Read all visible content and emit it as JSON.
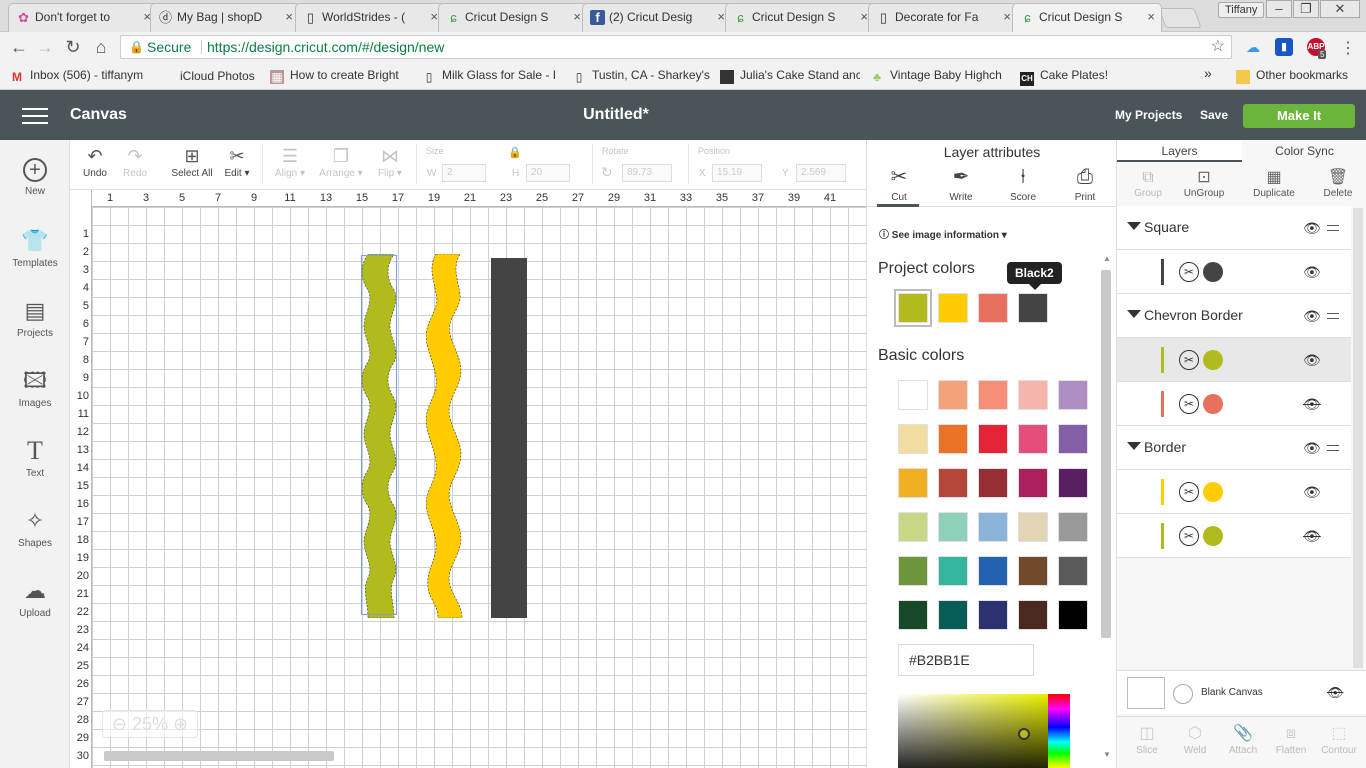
{
  "browser": {
    "tabs": [
      {
        "title": "Don't forget to",
        "icon": "flower-icon"
      },
      {
        "title": "My Bag | shopD",
        "icon": "shop-icon"
      },
      {
        "title": "WorldStrides - (",
        "icon": "page-icon"
      },
      {
        "title": "Cricut Design S",
        "icon": "cricut-icon"
      },
      {
        "title": "(2) Cricut Desig",
        "icon": "facebook-icon"
      },
      {
        "title": "Cricut Design S",
        "icon": "cricut-icon"
      },
      {
        "title": "Decorate for Fa",
        "icon": "page-icon"
      },
      {
        "title": "Cricut Design S",
        "icon": "cricut-icon"
      }
    ],
    "profile_name": "Tiffany",
    "address": {
      "secure_label": "Secure",
      "url": "https://design.cricut.com/#/design/new"
    },
    "ext_abp_count": "5",
    "bookmarks": [
      {
        "label": "Inbox (506) - tiffanym",
        "icon": "gmail-icon"
      },
      {
        "label": "iCloud Photos",
        "icon": "apple-icon"
      },
      {
        "label": "How to create Bright",
        "icon": "image-icon"
      },
      {
        "label": "Milk Glass for Sale - I",
        "icon": "page-icon"
      },
      {
        "label": "Tustin, CA - Sharkey's",
        "icon": "page-icon"
      },
      {
        "label": "Julia's Cake Stand anc",
        "icon": "cube-icon"
      },
      {
        "label": "Vintage Baby Highch",
        "icon": "cake-icon"
      },
      {
        "label": "Cake Plates!",
        "icon": "ch-icon"
      }
    ],
    "more_bookmarks": "»",
    "other_bookmarks": "Other bookmarks"
  },
  "app": {
    "section": "Canvas",
    "title": "Untitled*",
    "my_projects": "My Projects",
    "save": "Save",
    "make_it": "Make It"
  },
  "left_nav": [
    {
      "label": "New",
      "icon": "plus-circle-icon"
    },
    {
      "label": "Templates",
      "icon": "shirt-icon"
    },
    {
      "label": "Projects",
      "icon": "projects-icon"
    },
    {
      "label": "Images",
      "icon": "image-icon"
    },
    {
      "label": "Text",
      "icon": "text-icon"
    },
    {
      "label": "Shapes",
      "icon": "shapes-icon"
    },
    {
      "label": "Upload",
      "icon": "upload-icon"
    }
  ],
  "edit_toolbar": {
    "undo": "Undo",
    "redo": "Redo",
    "select_all": "Select All",
    "edit": "Edit",
    "align": "Align",
    "arrange": "Arrange",
    "flip": "Flip",
    "size_label": "Size",
    "w_label": "W",
    "w_value": "2",
    "h_label": "H",
    "h_value": "20",
    "rotate_label": "Rotate",
    "rotate_value": "89.73",
    "position_label": "Position",
    "x_label": "X",
    "x_value": "15.19",
    "y_label": "Y",
    "y_value": "2.569"
  },
  "canvas": {
    "ruler_top": [
      "1",
      "3",
      "5",
      "7",
      "9",
      "11",
      "13",
      "15",
      "17",
      "19",
      "21",
      "23",
      "25",
      "27",
      "29",
      "31",
      "33",
      "35",
      "37",
      "39",
      "41"
    ],
    "ruler_left": [
      "1",
      "2",
      "3",
      "4",
      "5",
      "6",
      "7",
      "8",
      "9",
      "10",
      "11",
      "12",
      "13",
      "14",
      "15",
      "16",
      "17",
      "18",
      "19",
      "20",
      "21",
      "22",
      "23",
      "24",
      "25",
      "26",
      "27",
      "28",
      "29",
      "30"
    ],
    "zoom": "25%",
    "shape_colors": {
      "chevron_green": "#B2BB1E",
      "chevron_yellow": "#FFCC00",
      "square_dark": "#444444"
    }
  },
  "attributes": {
    "heading": "Layer attributes",
    "types": [
      {
        "label": "Cut",
        "icon": "scissors-icon"
      },
      {
        "label": "Write",
        "icon": "pen-icon"
      },
      {
        "label": "Score",
        "icon": "score-icon"
      },
      {
        "label": "Print",
        "icon": "printer-icon"
      }
    ],
    "image_info": "See image information",
    "project_colors_label": "Project colors",
    "project_colors": [
      "#B2BB1E",
      "#FFCC00",
      "#E8705F",
      "#444444"
    ],
    "tooltip": "Black2",
    "basic_colors_label": "Basic colors",
    "basic_colors": [
      "#FFFFFF",
      "#F3A37A",
      "#F48E76",
      "#F6B5AC",
      "#AF8FC3",
      "#F2DDA0",
      "#EB7326",
      "#E32336",
      "#E54E7B",
      "#845EA7",
      "#F1AF23",
      "#B6453A",
      "#972E35",
      "#AC1F5D",
      "#5A1F63",
      "#C6D786",
      "#8FD0B8",
      "#8CB3D9",
      "#E2D5B6",
      "#999999",
      "#6D953A",
      "#33B69B",
      "#2262AF",
      "#714A2B",
      "#5A5A5A",
      "#174928",
      "#075B57",
      "#2C3270",
      "#4A2A20",
      "#000000"
    ],
    "hex_value": "#B2BB1E"
  },
  "layers": {
    "tabs": [
      "Layers",
      "Color Sync"
    ],
    "tools": [
      {
        "label": "Group",
        "icon": "group-icon",
        "enabled": false
      },
      {
        "label": "UnGroup",
        "icon": "ungroup-icon",
        "enabled": true
      },
      {
        "label": "Duplicate",
        "icon": "duplicate-icon",
        "enabled": true
      },
      {
        "label": "Delete",
        "icon": "trash-icon",
        "enabled": true
      }
    ],
    "groups": [
      {
        "name": "Square"
      },
      {
        "name": "Chevron Border"
      },
      {
        "name": "Border"
      }
    ],
    "blank_canvas": "Blank Canvas",
    "bottom_tools": [
      "Slice",
      "Weld",
      "Attach",
      "Flatten",
      "Contour"
    ]
  }
}
